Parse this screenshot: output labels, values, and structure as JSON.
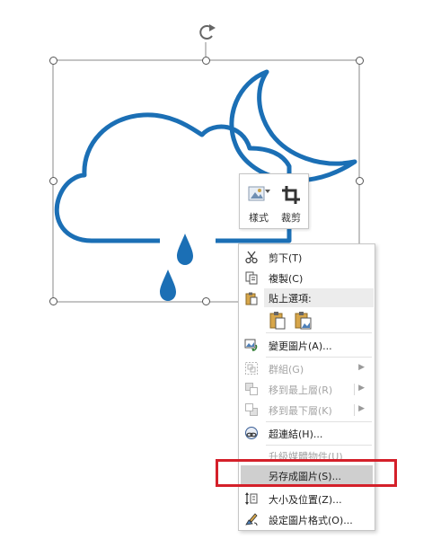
{
  "colors": {
    "shape": "#1b6fb5",
    "selection": "#555555",
    "menu_hover": "#cfcfcf",
    "callout": "#d4202a"
  },
  "mini_toolbar": {
    "style": {
      "label": "樣式",
      "icon": "style-gallery-icon"
    },
    "crop": {
      "label": "裁剪",
      "icon": "crop-icon"
    }
  },
  "context_menu": {
    "cut": {
      "label": "剪下(T)",
      "icon": "scissors-icon"
    },
    "copy": {
      "label": "複製(C)",
      "icon": "copy-icon"
    },
    "paste_options": {
      "label": "貼上選項:",
      "icon": "clipboard-icon"
    },
    "change_picture": {
      "label": "變更圖片(A)...",
      "icon": "change-picture-icon"
    },
    "group": {
      "label": "群組(G)",
      "icon": "group-icon",
      "disabled": true
    },
    "bring_to_front": {
      "label": "移到最上層(R)",
      "icon": "bring-front-icon",
      "disabled": true
    },
    "send_to_back": {
      "label": "移到最下層(K)",
      "icon": "send-back-icon",
      "disabled": true
    },
    "hyperlink": {
      "label": "超連結(H)...",
      "icon": "link-icon"
    },
    "upgrade_media": {
      "label": "升級媒體物件(U)",
      "disabled": true
    },
    "save_as_picture": {
      "label": "另存成圖片(S)...",
      "highlighted": true
    },
    "size_position": {
      "label": "大小及位置(Z)...",
      "icon": "size-position-icon"
    },
    "format_picture": {
      "label": "設定圖片格式(O)...",
      "icon": "format-picture-icon"
    }
  }
}
